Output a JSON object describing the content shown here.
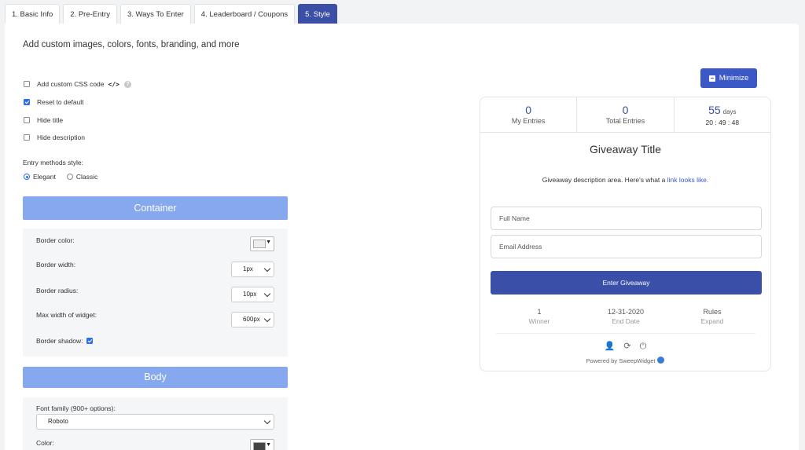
{
  "tabs": [
    {
      "label": "1. Basic Info",
      "active": false
    },
    {
      "label": "2. Pre-Entry",
      "active": false
    },
    {
      "label": "3. Ways To Enter",
      "active": false
    },
    {
      "label": "4. Leaderboard / Coupons",
      "active": false
    },
    {
      "label": "5. Style",
      "active": true
    }
  ],
  "heading": "Add custom images, colors, fonts, branding, and more",
  "options": {
    "custom_css": {
      "label": "Add custom CSS code",
      "checked": false,
      "icon": "code-icon"
    },
    "reset_default": {
      "label": "Reset to default",
      "checked": true
    },
    "hide_title": {
      "label": "Hide title",
      "checked": false
    },
    "hide_description": {
      "label": "Hide description",
      "checked": false
    }
  },
  "entry_methods": {
    "label": "Entry methods style:",
    "choices": [
      {
        "label": "Elegant",
        "selected": true
      },
      {
        "label": "Classic",
        "selected": false
      }
    ]
  },
  "container": {
    "title": "Container",
    "border_color_label": "Border color:",
    "border_color_value": "#eeeeee",
    "border_width_label": "Border width:",
    "border_width_value": "1px",
    "border_radius_label": "Border radius:",
    "border_radius_value": "10px",
    "max_width_label": "Max width of widget:",
    "max_width_value": "600px",
    "border_shadow_label": "Border shadow:",
    "border_shadow_checked": true
  },
  "body_section": {
    "title": "Body",
    "font_family_label": "Font family (900+ options):",
    "font_family_value": "Roboto",
    "color_label": "Color:",
    "color_value": "#444444"
  },
  "minimize_label": "Minimize",
  "widget": {
    "my_entries": {
      "value": "0",
      "label": "My Entries"
    },
    "total_entries": {
      "value": "0",
      "label": "Total Entries"
    },
    "days": {
      "value": "55",
      "unit": "days",
      "timer": "20 : 49 : 48"
    },
    "title": "Giveaway Title",
    "description": "Giveaway description area. Here's what a ",
    "description_link": "link looks like.",
    "full_name_placeholder": "Full Name",
    "email_placeholder": "Email Address",
    "enter_button": "Enter Giveaway",
    "footer": [
      {
        "value": "1",
        "label": "Winner"
      },
      {
        "value": "12-31-2020",
        "label": "End Date"
      },
      {
        "value": "Rules",
        "label": "Expand"
      }
    ],
    "powered_by": "Powered by SweepWidget"
  },
  "colors": {
    "accent": "#3a4fa5",
    "section_bar": "#86a8ee",
    "checkbox": "#2f6de1"
  }
}
